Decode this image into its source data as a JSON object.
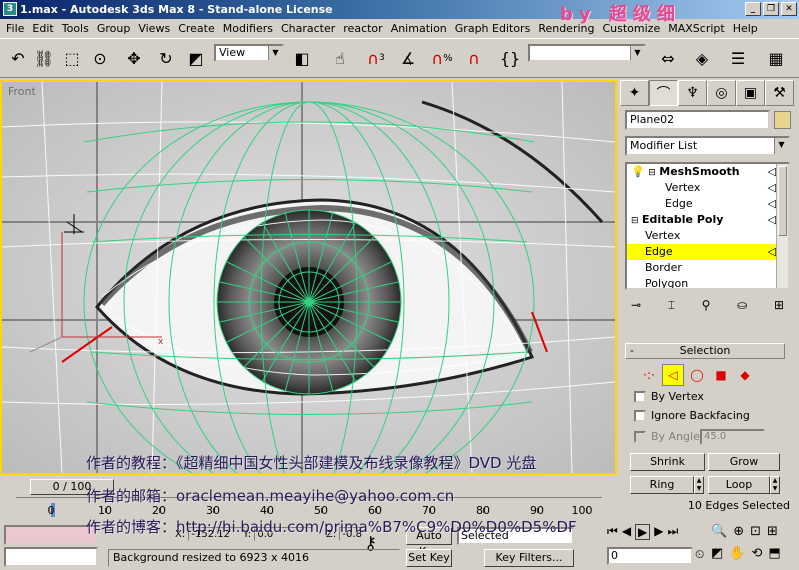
{
  "window": {
    "title": "1.max - Autodesk 3ds Max 8 - Stand-alone License",
    "app_icon_text": "3",
    "decoration": "by 超级细"
  },
  "menu": [
    "File",
    "Edit",
    "Tools",
    "Group",
    "Views",
    "Create",
    "Modifiers",
    "Character",
    "reactor",
    "Animation",
    "Graph Editors",
    "Rendering",
    "Customize",
    "MAXScript",
    "Help"
  ],
  "toolbar": {
    "view_label": "View",
    "snap_label": "3",
    "percent_label": "%"
  },
  "viewport": {
    "label": "Front",
    "active_border_color": "#ffd700",
    "wire_color": "#32d280"
  },
  "command_panel": {
    "tabs": [
      "create-icon",
      "modify-icon",
      "hierarchy-icon",
      "motion-icon",
      "display-icon",
      "utilities-icon"
    ],
    "object_name": "Plane02",
    "object_color": "#e6d58a",
    "modifier_list": "Modifier List",
    "stack": [
      {
        "label": "MeshSmooth",
        "level": 0,
        "bold": true
      },
      {
        "label": "Vertex",
        "level": 2
      },
      {
        "label": "Edge",
        "level": 2
      },
      {
        "label": "Editable Poly",
        "level": 0,
        "bold": true
      },
      {
        "label": "Vertex",
        "level": 1
      },
      {
        "label": "Edge",
        "level": 1,
        "highlight": true
      },
      {
        "label": "Border",
        "level": 1
      },
      {
        "label": "Polygon",
        "level": 1
      }
    ],
    "selection": {
      "title": "Selection",
      "collapse": "-",
      "by_vertex": "By Vertex",
      "ignore_backfacing": "Ignore Backfacing",
      "by_angle": "By Angle:",
      "angle_value": "45.0",
      "shrink": "Shrink",
      "grow": "Grow",
      "ring": "Ring",
      "loop": "Loop",
      "status": "10 Edges Selected"
    }
  },
  "timeline": {
    "slider_label": "0 / 100",
    "ticks": [
      "0",
      "10",
      "20",
      "30",
      "40",
      "50",
      "60",
      "70",
      "80",
      "90",
      "100"
    ],
    "current_frame": "0"
  },
  "status_bar": {
    "x_label": "X:",
    "x_value": "-152.12",
    "y_label": "Y:",
    "y_value": "0.0",
    "z_label": "Z:",
    "z_value": "-0.8",
    "message": "Background resized to 6923 x 4016",
    "auto_key": "Auto Key",
    "set_key": "Set Key",
    "selected": "Selected",
    "key_filters": "Key Filters...",
    "frame_field": "0"
  },
  "overlay": {
    "line1": "作者的教程：《超精细中国女性头部建模及布线录像教程》DVD 光盘",
    "line2": "作者的邮箱：oraclemean.meayihe@yahoo.com.cn",
    "line3": "作者的博客：http://hi.baidu.com/prima%B7%C9%D0%D0%D5%DF"
  }
}
